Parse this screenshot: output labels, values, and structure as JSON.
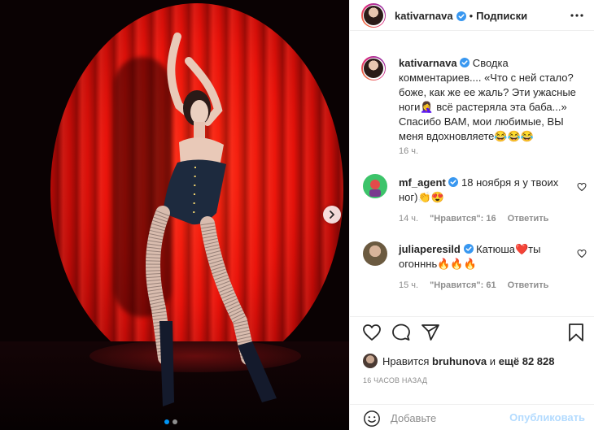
{
  "post": {
    "carousel_dots": 2,
    "active_dot": 0
  },
  "header": {
    "username": "kativarnava",
    "separator": "•",
    "follow_label": "Подписки"
  },
  "caption": {
    "username": "kativarnava",
    "text": " Сводка комментариев.... «Что с ней стало? боже, как же ее жаль? Эти ужасные ноги🤦‍♀️ всё растеряла эта баба...» Спасибо ВАМ, мои любимые, ВЫ меня вдохновляете😂😂😂",
    "time": "16 ч."
  },
  "comments": [
    {
      "username": "mf_agent",
      "verified": true,
      "text": " 18 ноября я у твоих ног)👏😍",
      "time": "14 ч.",
      "likes_label": "\"Нравится\": 16",
      "reply_label": "Ответить"
    },
    {
      "username": "juliaperesild",
      "verified": true,
      "text": " Катюша❤️ты огонннь🔥🔥🔥",
      "time": "15 ч.",
      "likes_label": "\"Нравится\": 61",
      "reply_label": "Ответить"
    }
  ],
  "likes": {
    "prefix": "Нравится",
    "user": "bruhunova",
    "middle": "и",
    "rest": "ещё 82 828"
  },
  "posted": "16 ЧАСОВ НАЗАД",
  "add_comment": {
    "placeholder": "Добавьте",
    "publish_label": "Опубликовать"
  },
  "colors": {
    "verified_blue": "#3897f0",
    "publish_disabled": "#b3dbff",
    "accent": "#0095f6"
  }
}
